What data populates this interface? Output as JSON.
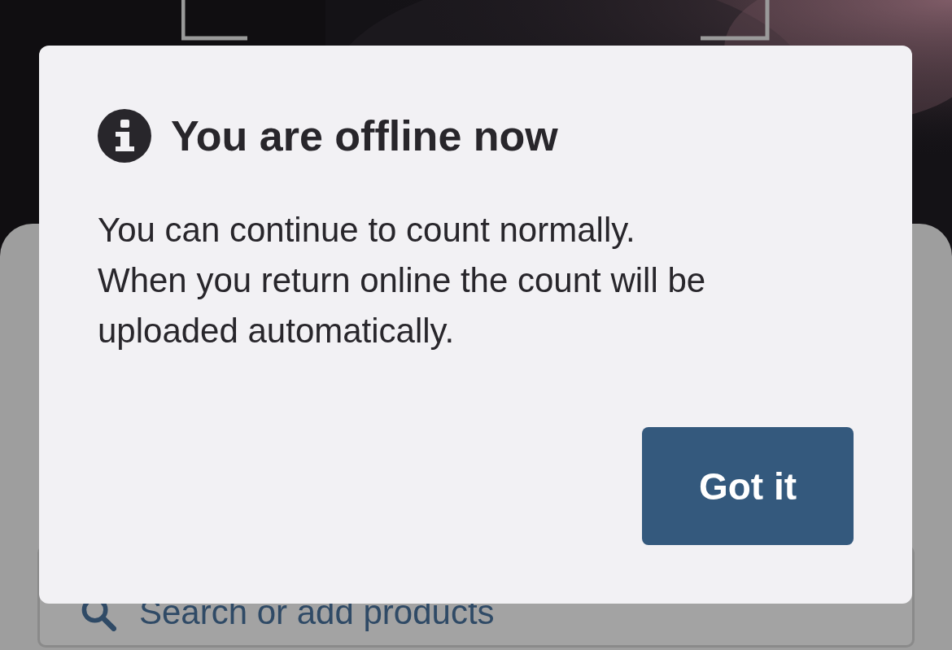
{
  "search": {
    "placeholder": "Search or add products"
  },
  "dialog": {
    "title": "You are offline now",
    "message_lines": [
      "You can continue to count normally.",
      "When you return online the count will be",
      "uploaded automatically."
    ],
    "button": "Got it"
  }
}
